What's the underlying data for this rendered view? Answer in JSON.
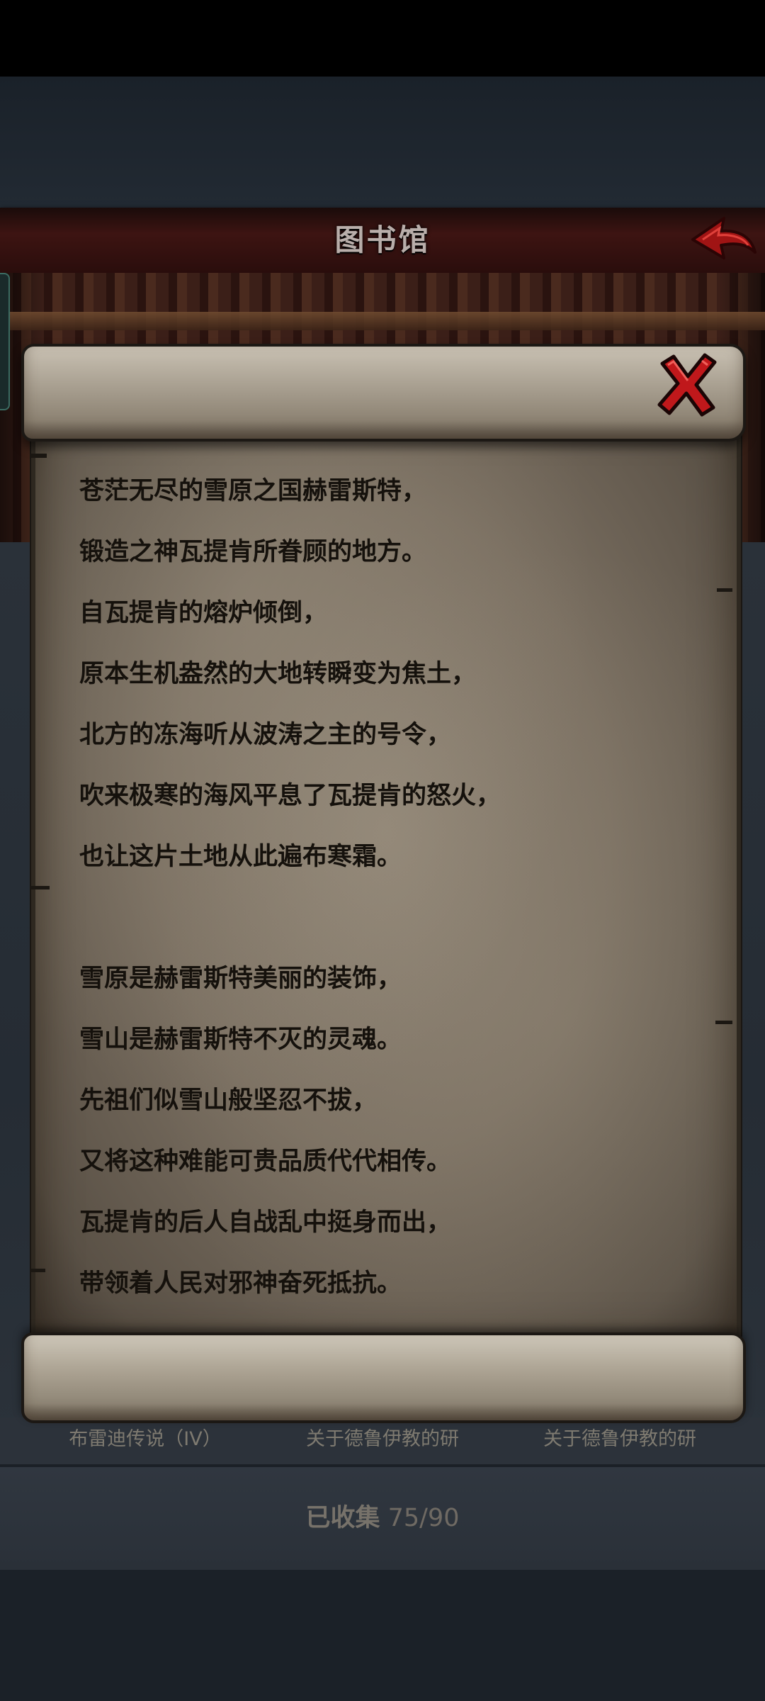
{
  "header": {
    "title": "图书馆"
  },
  "scroll": {
    "stanza1": [
      "苍茫无尽的雪原之国赫雷斯特，",
      "锻造之神瓦提肯所眷顾的地方。",
      "自瓦提肯的熔炉倾倒，",
      "原本生机盎然的大地转瞬变为焦土，",
      "北方的冻海听从波涛之主的号令，",
      "吹来极寒的海风平息了瓦提肯的怒火，",
      "也让这片土地从此遍布寒霜。"
    ],
    "stanza2": [
      "雪原是赫雷斯特美丽的装饰，",
      "雪山是赫雷斯特不灭的灵魂。",
      "先祖们似雪山般坚忍不拔，",
      "又将这种难能可贵品质代代相传。",
      "瓦提肯的后人自战乱中挺身而出，",
      "带领着人民对邪神奋死抵抗。"
    ]
  },
  "tabs": [
    {
      "label": "布雷迪传说（IV）"
    },
    {
      "label": "关于德鲁伊教的研"
    },
    {
      "label": "关于德鲁伊教的研"
    }
  ],
  "collection": {
    "label": "已收集",
    "count": "75/90"
  },
  "colors": {
    "header": "#3d1412",
    "parchment": "#8e8374",
    "close_red": "#c0181b",
    "back_red": "#a01414"
  },
  "icons": {
    "back": "back-arrow-icon",
    "close": "close-x-icon"
  }
}
